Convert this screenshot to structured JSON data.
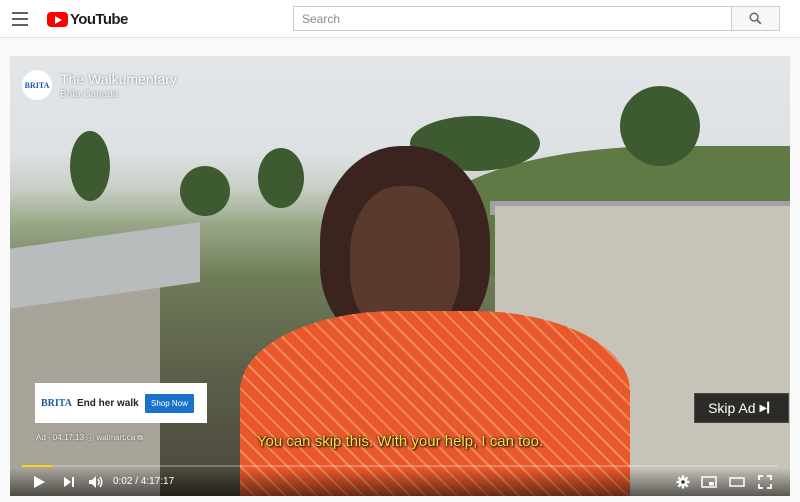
{
  "header": {
    "logo_text": "YouTube",
    "search_placeholder": "Search"
  },
  "ad": {
    "channel_title": "The Walkumentary",
    "channel_subtitle": "Brita Canada",
    "channel_logo": "BRITA",
    "card_logo": "BRITA",
    "card_text": "End her walk",
    "card_button": "Shop Now",
    "meta": "Ad · 04:17:13 ⓘ walmart.ca ⧉",
    "skip_label": "Skip Ad"
  },
  "subtitle": "You can skip this. With your help, I can too.",
  "player": {
    "time_display": "0:02 / 4:17:17",
    "progress_fraction": 0.04,
    "progress_color": "#fcd116"
  },
  "icons": [
    "menu-icon",
    "youtube-logo-icon",
    "search-icon",
    "play-icon",
    "next-icon",
    "volume-icon",
    "settings-icon",
    "miniplayer-icon",
    "theater-icon",
    "fullscreen-icon",
    "skip-icon"
  ]
}
